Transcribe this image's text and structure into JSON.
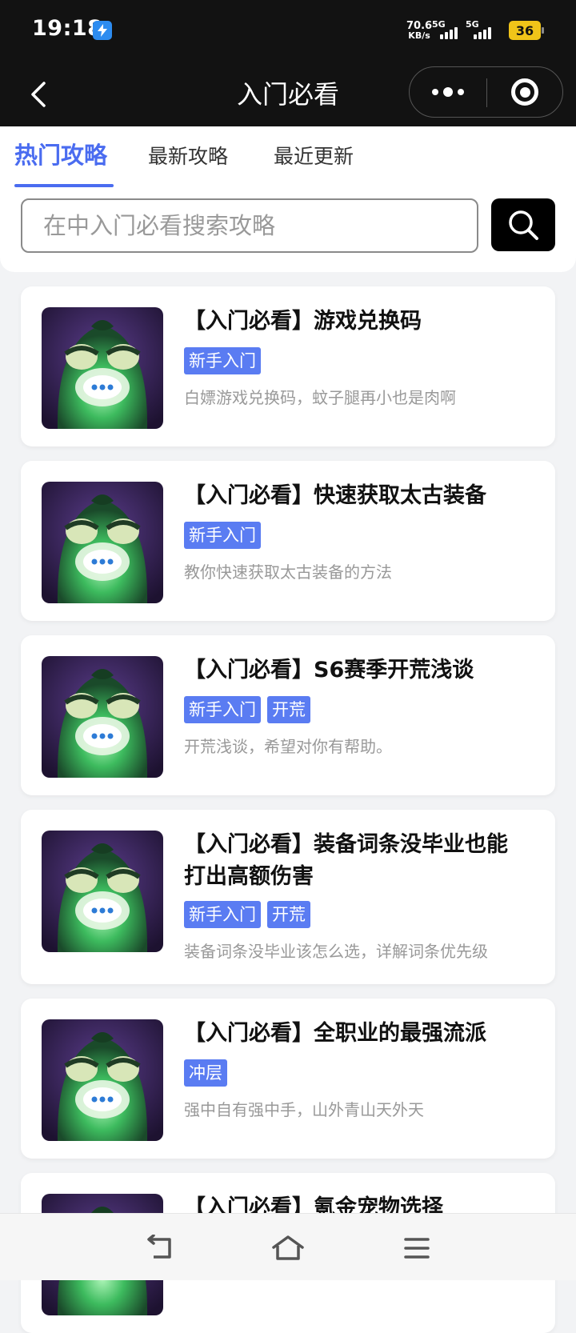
{
  "status_bar": {
    "time": "19:18",
    "net_speed_value": "70.6",
    "net_speed_unit": "KB/s",
    "sim1_label": "5G",
    "sim2_label": "5G",
    "battery": "36"
  },
  "nav": {
    "title": "入门必看"
  },
  "tabs": [
    {
      "label": "热门攻略",
      "active": true
    },
    {
      "label": "最新攻略",
      "active": false
    },
    {
      "label": "最近更新",
      "active": false
    }
  ],
  "search": {
    "placeholder": "在中入门必看搜索攻略"
  },
  "articles": [
    {
      "title_line1": "【入门必看】游戏兑换码",
      "title_line2": "",
      "tags": [
        "新手入门"
      ],
      "description": "白嫖游戏兑换码，蚊子腿再小也是肉啊"
    },
    {
      "title_line1": "【入门必看】快速获取太古装备",
      "title_line2": "",
      "tags": [
        "新手入门"
      ],
      "description": "教你快速获取太古装备的方法"
    },
    {
      "title_line1": "【入门必看】S6赛季开荒浅谈",
      "title_line2": "",
      "tags": [
        "新手入门",
        "开荒"
      ],
      "description": "开荒浅谈，希望对你有帮助。"
    },
    {
      "title_line1": "【入门必看】装备词条没毕业也能",
      "title_line2": "打出高额伤害",
      "tags": [
        "新手入门",
        "开荒"
      ],
      "description": "装备词条没毕业该怎么选，详解词条优先级"
    },
    {
      "title_line1": "【入门必看】全职业的最强流派",
      "title_line2": "",
      "tags": [
        "冲层"
      ],
      "description": "强中自有强中手，山外青山天外天"
    },
    {
      "title_line1": "【入门必看】氪金宠物选择",
      "title_line2": "",
      "tags": [],
      "description": ""
    }
  ],
  "colors": {
    "accent": "#4a6cf0",
    "tag_bg": "#5a7cf2",
    "header_bg": "#121212",
    "page_bg": "#f2f3f5"
  },
  "icons": {
    "back": "chevron-left-icon",
    "more": "more-dots-icon",
    "close": "target-close-icon",
    "search": "search-icon",
    "sys_back": "system-back-icon",
    "sys_home": "system-home-icon",
    "sys_menu": "system-menu-icon"
  }
}
